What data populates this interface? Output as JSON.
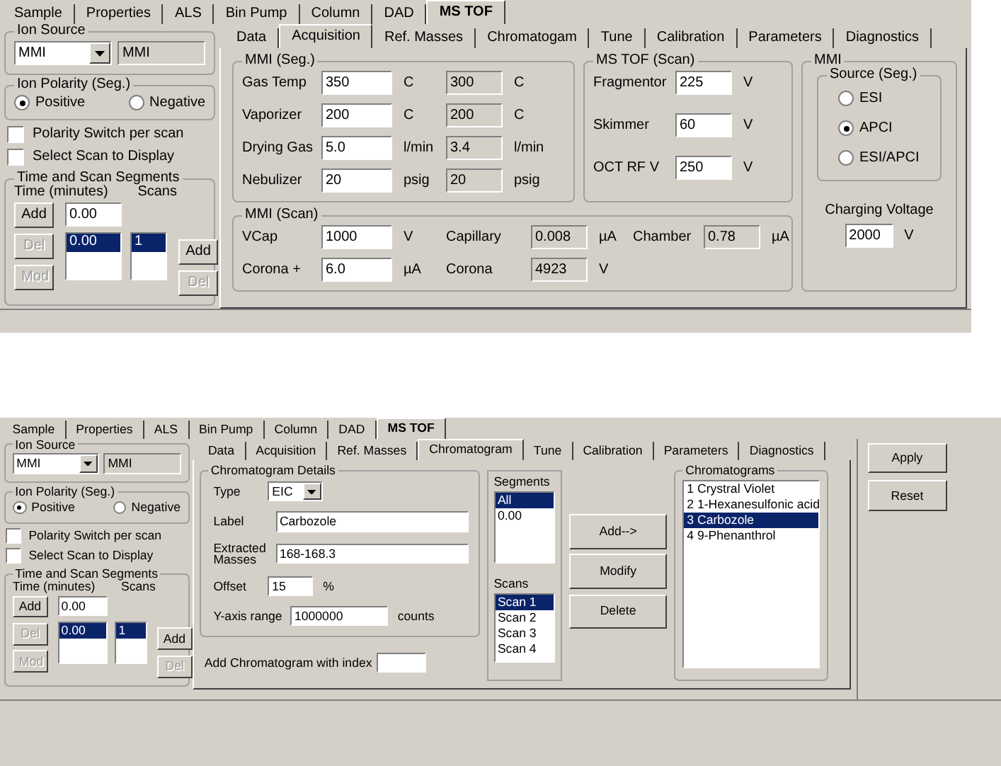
{
  "windows": [
    {
      "kind": "acquisition",
      "main_tabs": [
        {
          "label": "Sample",
          "selected": false
        },
        {
          "label": "Properties",
          "selected": false
        },
        {
          "label": "ALS",
          "selected": false
        },
        {
          "label": "Bin Pump",
          "selected": false
        },
        {
          "label": "Column",
          "selected": false
        },
        {
          "label": "DAD",
          "selected": false
        },
        {
          "label": "MS TOF",
          "selected": true
        }
      ],
      "left": {
        "ion_source": {
          "title": "Ion Source",
          "value": "MMI",
          "readback": "MMI"
        },
        "ion_polarity": {
          "title": "Ion Polarity (Seg.)",
          "options": [
            {
              "label": "Positive",
              "selected": true
            },
            {
              "label": "Negative",
              "selected": false
            }
          ]
        },
        "checkboxes": [
          {
            "label": "Polarity Switch per scan",
            "checked": false
          },
          {
            "label": "Select Scan to Display",
            "checked": false
          }
        ],
        "segments": {
          "title": "Time and Scan Segments",
          "time_label": "Time  (minutes)",
          "scans_label": "Scans",
          "time_value": "0.00",
          "times": [
            {
              "label": "0.00",
              "selected": true
            }
          ],
          "scans": [
            {
              "label": "1",
              "selected": true
            }
          ],
          "buttons": [
            {
              "label": "Add",
              "disabled": false
            },
            {
              "label": "Del",
              "disabled": true
            },
            {
              "label": "Mod",
              "disabled": true
            }
          ],
          "scan_buttons": [
            {
              "label": "Add",
              "disabled": false
            },
            {
              "label": "Del",
              "disabled": true
            }
          ]
        }
      },
      "sub_tabs": [
        {
          "label": "Data",
          "selected": false
        },
        {
          "label": "Acquisition",
          "selected": true
        },
        {
          "label": "Ref. Masses",
          "selected": false
        },
        {
          "label": "Chromatogam",
          "selected": false
        },
        {
          "label": "Tune",
          "selected": false
        },
        {
          "label": "Calibration",
          "selected": false
        },
        {
          "label": "Parameters",
          "selected": false
        },
        {
          "label": "Diagnostics",
          "selected": false
        }
      ],
      "mmi_seg": {
        "title": "MMI (Seg.)",
        "rows": [
          {
            "label": "Gas Temp",
            "value": "350",
            "unit": "C",
            "actual": "300",
            "actual_unit": "C"
          },
          {
            "label": "Vaporizer",
            "value": "200",
            "unit": "C",
            "actual": "200",
            "actual_unit": "C"
          },
          {
            "label": "Drying Gas",
            "value": "5.0",
            "unit": "l/min",
            "actual": "3.4",
            "actual_unit": "l/min"
          },
          {
            "label": "Nebulizer",
            "value": "20",
            "unit": "psig",
            "actual": "20",
            "actual_unit": "psig"
          }
        ]
      },
      "ms_tof": {
        "title": "MS TOF (Scan)",
        "rows": [
          {
            "label": "Fragmentor",
            "value": "225",
            "unit": "V"
          },
          {
            "label": "Skimmer",
            "value": "60",
            "unit": "V"
          },
          {
            "label": "OCT RF V",
            "value": "250",
            "unit": "V"
          }
        ]
      },
      "mmi_scan": {
        "title": "MMI (Scan)",
        "rows": [
          {
            "label": "VCap",
            "value": "1000",
            "unit": "V"
          },
          {
            "label": "Corona +",
            "value": "6.0",
            "unit": "µA"
          }
        ],
        "readbacks": [
          {
            "label": "Capillary",
            "value": "0.008",
            "unit": "µA"
          },
          {
            "label": "Corona",
            "value": "4923",
            "unit": "V"
          },
          {
            "label": "Chamber",
            "value": "0.78",
            "unit": "µA"
          }
        ]
      },
      "mmi": {
        "title": "MMI",
        "source": {
          "title": "Source (Seg.)",
          "options": [
            {
              "label": "ESI",
              "selected": false
            },
            {
              "label": "APCI",
              "selected": true
            },
            {
              "label": "ESI/APCI",
              "selected": false
            }
          ]
        },
        "charging": {
          "label": "Charging Voltage",
          "value": "2000",
          "unit": "V"
        }
      }
    },
    {
      "kind": "chromatogram",
      "main_tabs": [
        {
          "label": "Sample",
          "selected": false
        },
        {
          "label": "Properties",
          "selected": false
        },
        {
          "label": "ALS",
          "selected": false
        },
        {
          "label": "Bin Pump",
          "selected": false
        },
        {
          "label": "Column",
          "selected": false
        },
        {
          "label": "DAD",
          "selected": false
        },
        {
          "label": "MS TOF",
          "selected": true
        }
      ],
      "left": {
        "ion_source": {
          "title": "Ion Source",
          "value": "MMI",
          "readback": "MMI"
        },
        "ion_polarity": {
          "title": "Ion Polarity (Seg.)",
          "options": [
            {
              "label": "Positive",
              "selected": true
            },
            {
              "label": "Negative",
              "selected": false
            }
          ]
        },
        "checkboxes": [
          {
            "label": "Polarity Switch per scan",
            "checked": false
          },
          {
            "label": "Select Scan to Display",
            "checked": false
          }
        ],
        "segments": {
          "title": "Time and Scan Segments",
          "time_label": "Time  (minutes)",
          "scans_label": "Scans",
          "time_value": "0.00",
          "times": [
            {
              "label": "0.00",
              "selected": true
            }
          ],
          "scans": [
            {
              "label": "1",
              "selected": true
            }
          ],
          "buttons": [
            {
              "label": "Add",
              "disabled": false
            },
            {
              "label": "Del",
              "disabled": true
            },
            {
              "label": "Mod",
              "disabled": true
            }
          ],
          "scan_buttons": [
            {
              "label": "Add",
              "disabled": false
            },
            {
              "label": "Del",
              "disabled": true
            }
          ]
        }
      },
      "sub_tabs": [
        {
          "label": "Data",
          "selected": false
        },
        {
          "label": "Acquisition",
          "selected": false
        },
        {
          "label": "Ref. Masses",
          "selected": false
        },
        {
          "label": "Chromatogram",
          "selected": true
        },
        {
          "label": "Tune",
          "selected": false
        },
        {
          "label": "Calibration",
          "selected": false
        },
        {
          "label": "Parameters",
          "selected": false
        },
        {
          "label": "Diagnostics",
          "selected": false
        }
      ],
      "details": {
        "title": "Chromatogram Details",
        "type": {
          "label": "Type",
          "value": "EIC"
        },
        "fields": [
          {
            "label": "Label",
            "value": "Carbozole"
          },
          {
            "label": "Extracted Masses",
            "value": "168-168.3"
          }
        ],
        "offset": {
          "label": "Offset",
          "value": "15",
          "unit": "%"
        },
        "y_range": {
          "label": "Y-axis range",
          "value": "1000000",
          "unit": "counts"
        }
      },
      "add_index": {
        "label": "Add Chromatogram with index"
      },
      "segments": {
        "title": "Segments",
        "items": [
          {
            "label": "All",
            "selected": true
          },
          {
            "label": "0.00",
            "selected": false
          }
        ]
      },
      "scans": {
        "title": "Scans",
        "items": [
          {
            "label": "Scan 1",
            "selected": true
          },
          {
            "label": "Scan 2",
            "selected": false
          },
          {
            "label": "Scan 3",
            "selected": false
          },
          {
            "label": "Scan 4",
            "selected": false
          }
        ]
      },
      "actions": [
        "Add-->",
        "Modify",
        "Delete"
      ],
      "chromatograms": {
        "title": "Chromatograms",
        "items": [
          {
            "label": "1 Crystral Violet",
            "selected": false
          },
          {
            "label": "2 1-Hexanesulfonic acid",
            "selected": false
          },
          {
            "label": "3 Carbozole",
            "selected": true
          },
          {
            "label": "4 9-Phenanthrol",
            "selected": false
          }
        ]
      },
      "side_buttons": [
        "Apply",
        "Reset"
      ]
    }
  ]
}
